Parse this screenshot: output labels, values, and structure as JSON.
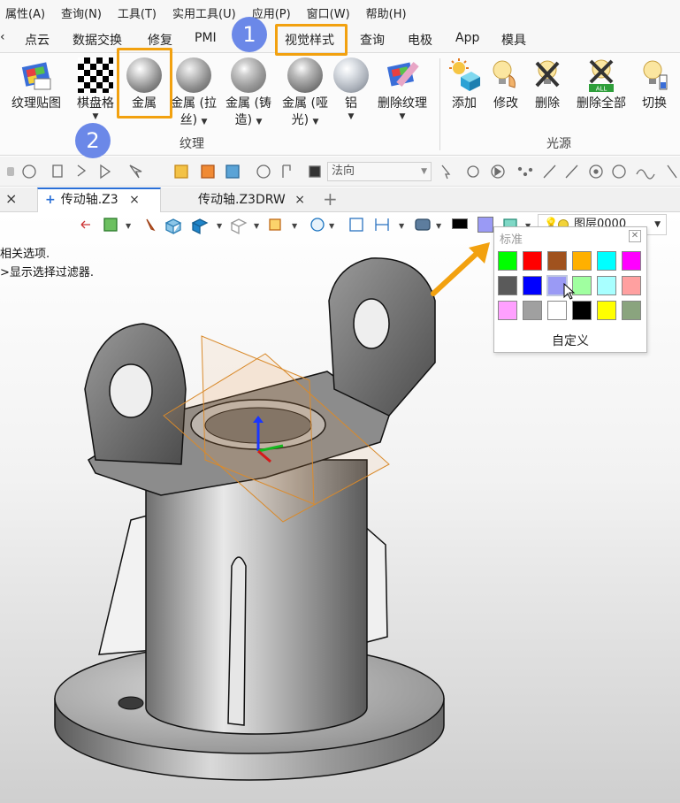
{
  "menu": [
    "属性(A)",
    "查询(N)",
    "工具(T)",
    "实用工具(U)",
    "应用(P)",
    "窗口(W)",
    "帮助(H)"
  ],
  "ribbon_tabs": [
    "点云",
    "数据交换",
    "修复",
    "PMI",
    "视觉样式",
    "查询",
    "电极",
    "App",
    "模具"
  ],
  "ribbon": {
    "texture_buttons": [
      {
        "label": "纹理贴图",
        "label2": ""
      },
      {
        "label": "棋盘格",
        "label2": ""
      },
      {
        "label": "金属",
        "label2": ""
      },
      {
        "label": "金属 (拉",
        "label2": "丝)"
      },
      {
        "label": "金属 (铸",
        "label2": "造)"
      },
      {
        "label": "金属 (哑",
        "label2": "光)"
      },
      {
        "label": "铝",
        "label2": ""
      },
      {
        "label": "删除纹理",
        "label2": ""
      }
    ],
    "texture_group": "纹理",
    "light_buttons": [
      {
        "label": "添加"
      },
      {
        "label": "修改"
      },
      {
        "label": "删除"
      },
      {
        "label": "删除全部"
      },
      {
        "label": "切换"
      }
    ],
    "light_group": "光源"
  },
  "toolbar2": {
    "select_value": "法向"
  },
  "doc_tabs": [
    {
      "label": "传动轴.Z3",
      "active": true
    },
    {
      "label": "传动轴.Z3DRW",
      "active": false
    }
  ],
  "view_toolbar": {
    "layer_label": "图层0000",
    "color_black": "#000000",
    "color_current": "#9a9af5"
  },
  "hints": [
    "相关选项.",
    ">显示选择过滤器."
  ],
  "palette": {
    "title": "标准",
    "custom_label": "自定义",
    "colors": [
      "#00ff00",
      "#ff0000",
      "#a0521e",
      "#ffb000",
      "#00ffff",
      "#ff00ff",
      "#5a5a5a",
      "#0000ff",
      "#9a9af5",
      "#a0ffa0",
      "#a8ffff",
      "#ffa0a0",
      "#ffa0ff",
      "#a0a0a0",
      "#ffffff",
      "#000000",
      "#ffff00",
      "#8aa47e"
    ]
  },
  "callouts": [
    "1",
    "2"
  ]
}
